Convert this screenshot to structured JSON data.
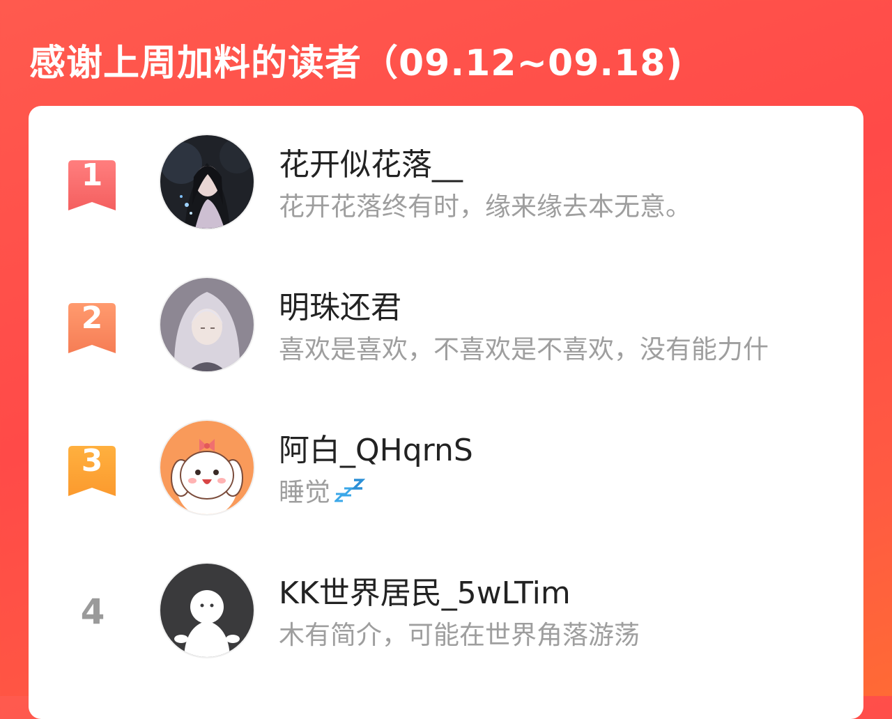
{
  "header": {
    "title": "感谢上周加料的读者（09.12~09.18)"
  },
  "readers": [
    {
      "rank": "1",
      "badge_color": "#f56b6b",
      "name": "花开似花落__",
      "bio": "花开花落终有时，缘来缘去本无意。",
      "avatar_icon": "anime-girl-avatar"
    },
    {
      "rank": "2",
      "badge_color": "#f78a5e",
      "name": "明珠还君",
      "bio": "喜欢是喜欢，不喜欢是不喜欢，没有能力什",
      "avatar_icon": "white-hair-girl-avatar"
    },
    {
      "rank": "3",
      "badge_color": "#fba43a",
      "name": "阿白_QHqrnS",
      "bio": "睡觉",
      "bio_emoji": "zzz-sleep-icon",
      "avatar_icon": "puppy-avatar"
    },
    {
      "rank": "4",
      "name": "KK世界居民_5wLTim",
      "bio": "木有简介，可能在世界角落游荡",
      "avatar_icon": "default-ghost-avatar"
    }
  ]
}
